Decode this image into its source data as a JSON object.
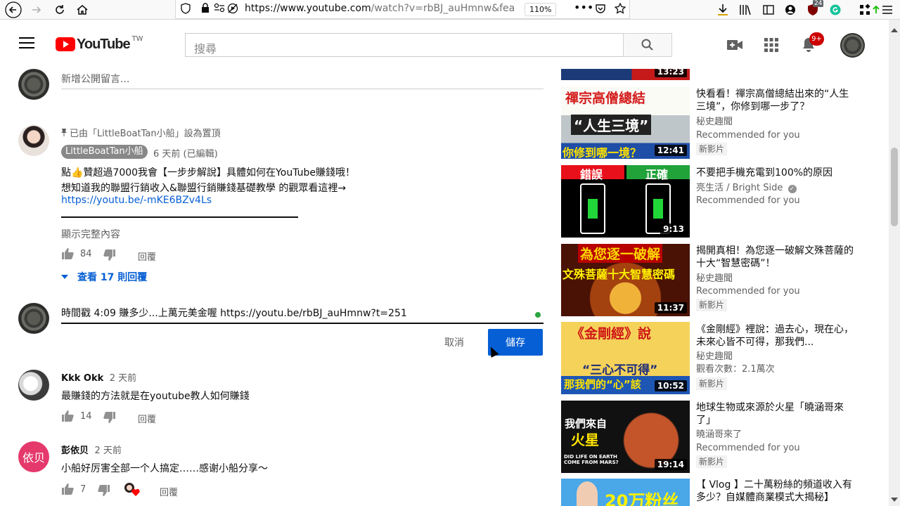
{
  "browser": {
    "url_host": "https://www.youtube.com",
    "url_rest": "/watch?v=rbBJ_auHmnw&fea",
    "zoom": "110%",
    "extension_badge": "24"
  },
  "header": {
    "logo_text": "YouTube",
    "logo_region": "TW",
    "search_placeholder": "搜尋",
    "notification_count": "9+"
  },
  "new_comment": {
    "placeholder": "新增公開留言..."
  },
  "pinned_comment": {
    "pinned_label": "已由「LittleBoatTan小船」設為置頂",
    "author": "LittleBoatTan小船",
    "time": "6 天前 (已編輯)",
    "line1": "點👍贊超過7000我會【一步步解說】具體如何在YouTube賺錢哦！",
    "line2": "想知道我的聯盟行銷收入&聯盟行銷賺錢基礎教學 的觀眾看這裡→",
    "link": "https://youtu.be/-mKE6BZv4Ls",
    "show_more": "顯示完整內容",
    "likes": "84",
    "reply_label": "回覆",
    "view_replies": "查看 17 則回覆"
  },
  "editing_comment": {
    "text": "時間戳 4:09 賺多少...上萬元美金喔 https://youtu.be/rbBJ_auHmnw?t=251",
    "cancel_label": "取消",
    "save_label": "儲存"
  },
  "comments": [
    {
      "author": "Kkk Okk",
      "time": "2 天前",
      "text": "最賺錢的方法就是在youtube教人如何賺錢",
      "likes": "14",
      "reply_label": "回覆"
    },
    {
      "author": "彭依贝",
      "time": "2 天前",
      "avatar_text": "依贝",
      "text": "小船好厉害全部一个人搞定……感谢小船分享～",
      "likes": "7",
      "reply_label": "回覆"
    }
  ],
  "sidebar": {
    "top_duration": "13:23",
    "videos": [
      {
        "title": "快看看！禪宗高僧總結出來的“人生三境”，你修到哪一步了？",
        "channel": "秘史趣聞",
        "meta": "Recommended for you",
        "badge": "新影片",
        "duration": "12:41",
        "thumb_text1": "禪宗高僧總結",
        "thumb_text2": "“人生三境”",
        "thumb_text3": "你修到哪一境？"
      },
      {
        "title": "不要把手機充電到100%的原因",
        "channel": "亮生活 / Bright Side",
        "meta": "Recommended for you",
        "duration": "9:13",
        "thumb_text1": "錯誤",
        "thumb_text2": "正確"
      },
      {
        "title": "揭開真相！為您逐一破解文殊菩薩的十大“智慧密碼”！",
        "channel": "秘史趣聞",
        "meta": "Recommended for you",
        "badge": "新影片",
        "duration": "11:37",
        "thumb_text1": "為您逐一破解",
        "thumb_text2": "文殊菩薩十大智慧密碼"
      },
      {
        "title": "《金剛經》裡說：過去心，現在心，未來心皆不可得，那我們...",
        "channel": "秘史趣聞",
        "meta": "觀看次數：2.1萬次",
        "badge": "新影片",
        "duration": "10:52",
        "thumb_text1": "《金剛經》說",
        "thumb_text2": "“三心不可得”",
        "thumb_text3": "那我們的“心”該"
      },
      {
        "title": "地球生物或來源於火星「曉涵哥來了」",
        "channel": "曉涵哥來了",
        "meta": "Recommended for you",
        "badge": "新影片",
        "duration": "19:14",
        "thumb_text1": "我們來自",
        "thumb_text2": "火星",
        "thumb_text3": "DID LIFE ON EARTH COME FROM MARS?"
      },
      {
        "title": "【 Vlog 】二十萬粉絲的頻道收入有多少？自媒體商業模式大揭秘】",
        "thumb_text1": "20万粉丝"
      }
    ]
  }
}
